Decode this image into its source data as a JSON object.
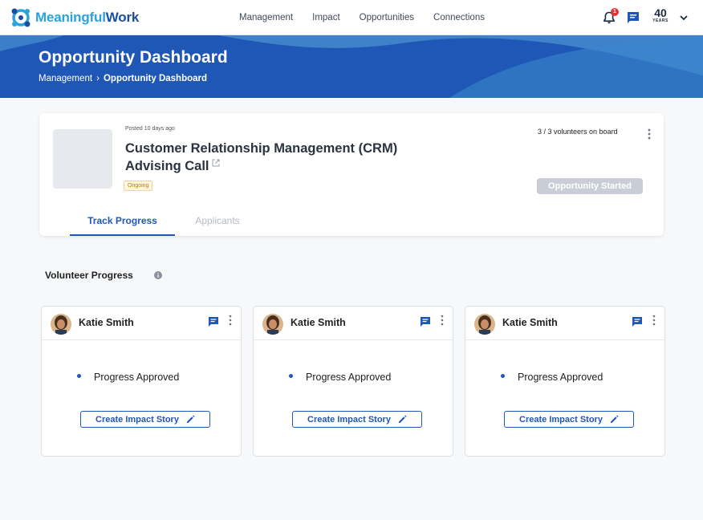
{
  "app": {
    "brand_part1": "Meaningful",
    "brand_part2": "Work",
    "brand_color_light": "#2aa3d8",
    "brand_color_dark": "#1b4da0"
  },
  "nav": {
    "links": [
      "Management",
      "Impact",
      "Opportunities",
      "Connections"
    ],
    "notification_count": "1",
    "years_number": "40",
    "years_label": "YEARS"
  },
  "hero": {
    "title": "Opportunity Dashboard",
    "breadcrumb_root": "Management",
    "breadcrumb_sep": "›",
    "breadcrumb_current": "Opportunity Dashboard"
  },
  "opportunity": {
    "posted": "Posted 10 days ago",
    "title": "Customer Relationship Management (CRM) Advising Call",
    "status": "Ongoing",
    "volunteers": "3 / 3 volunteers on board",
    "action_label": "Opportunity Started",
    "tabs": [
      "Track Progress",
      "Applicants"
    ],
    "active_tab": "Track Progress"
  },
  "progress": {
    "heading": "Volunteer Progress",
    "volunteers": [
      {
        "name": "Katie Smith",
        "status": "Progress Approved",
        "action": "Create Impact Story"
      },
      {
        "name": "Katie Smith",
        "status": "Progress Approved",
        "action": "Create Impact Story"
      },
      {
        "name": "Katie Smith",
        "status": "Progress Approved",
        "action": "Create Impact Story"
      }
    ]
  },
  "colors": {
    "primary": "#1f57b7",
    "badge_red": "#e0343a",
    "ongoing_text": "#b07c1a",
    "disabled_button": "#c9ced6"
  },
  "icons": [
    "logo-icon",
    "bell-icon",
    "chat-icon",
    "chevron-down-icon",
    "external-link-icon",
    "kebab-menu-icon",
    "info-icon",
    "pencil-icon"
  ]
}
